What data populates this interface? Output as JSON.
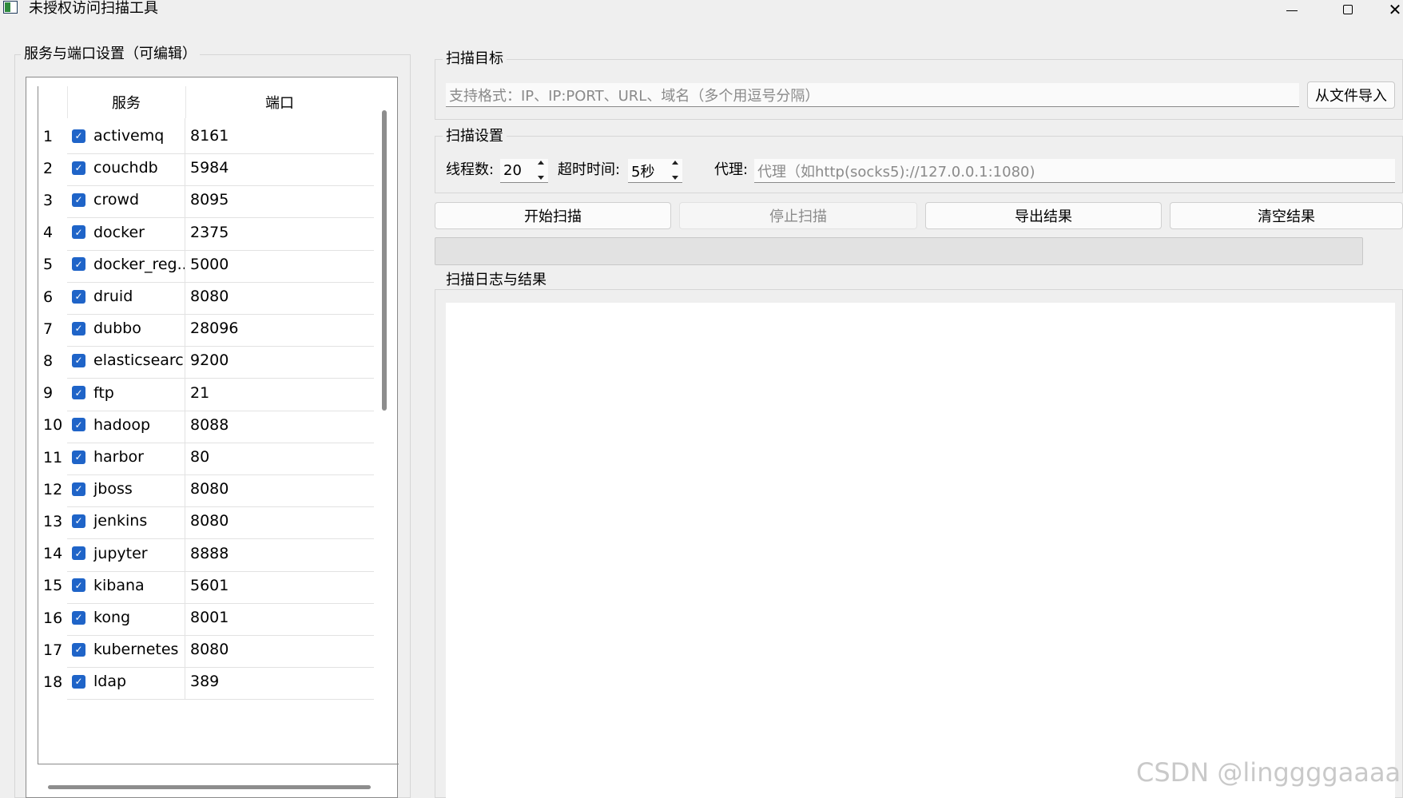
{
  "window": {
    "title": "未授权访问扫描工具",
    "close_glyph": "✕"
  },
  "services_panel": {
    "title": "服务与端口设置（可编辑）",
    "columns": [
      "服务",
      "端口"
    ],
    "rows": [
      {
        "num": "1",
        "service": "activemq",
        "port": "8161",
        "checked": true
      },
      {
        "num": "2",
        "service": "couchdb",
        "port": "5984",
        "checked": true
      },
      {
        "num": "3",
        "service": "crowd",
        "port": "8095",
        "checked": true
      },
      {
        "num": "4",
        "service": "docker",
        "port": "2375",
        "checked": true
      },
      {
        "num": "5",
        "service": "docker_reg...",
        "port": "5000",
        "checked": true
      },
      {
        "num": "6",
        "service": "druid",
        "port": "8080",
        "checked": true
      },
      {
        "num": "7",
        "service": "dubbo",
        "port": "28096",
        "checked": true
      },
      {
        "num": "8",
        "service": "elasticsearch",
        "port": "9200",
        "checked": true
      },
      {
        "num": "9",
        "service": "ftp",
        "port": "21",
        "checked": true
      },
      {
        "num": "10",
        "service": "hadoop",
        "port": "8088",
        "checked": true
      },
      {
        "num": "11",
        "service": "harbor",
        "port": "80",
        "checked": true
      },
      {
        "num": "12",
        "service": "jboss",
        "port": "8080",
        "checked": true
      },
      {
        "num": "13",
        "service": "jenkins",
        "port": "8080",
        "checked": true
      },
      {
        "num": "14",
        "service": "jupyter",
        "port": "8888",
        "checked": true
      },
      {
        "num": "15",
        "service": "kibana",
        "port": "5601",
        "checked": true
      },
      {
        "num": "16",
        "service": "kong",
        "port": "8001",
        "checked": true
      },
      {
        "num": "17",
        "service": "kubernetes",
        "port": "8080",
        "checked": true
      },
      {
        "num": "18",
        "service": "ldap",
        "port": "389",
        "checked": true
      }
    ]
  },
  "target": {
    "title": "扫描目标",
    "placeholder": "支持格式：IP、IP:PORT、URL、域名（多个用逗号分隔）",
    "import_label": "从文件导入"
  },
  "settings": {
    "title": "扫描设置",
    "threads_label": "线程数:",
    "threads_value": "20",
    "timeout_label": "超时时间:",
    "timeout_value": "5秒",
    "proxy_label": "代理:",
    "proxy_placeholder": "代理（如http(socks5)://127.0.0.1:1080)"
  },
  "actions": {
    "start": "开始扫描",
    "stop": "停止扫描",
    "export": "导出结果",
    "clear": "清空结果"
  },
  "progress": {
    "value": 0
  },
  "log": {
    "title": "扫描日志与结果"
  },
  "watermark": "CSDN @linggggaaaa",
  "colors": {
    "checkbox": "#1f64c8",
    "background": "#efefef"
  }
}
